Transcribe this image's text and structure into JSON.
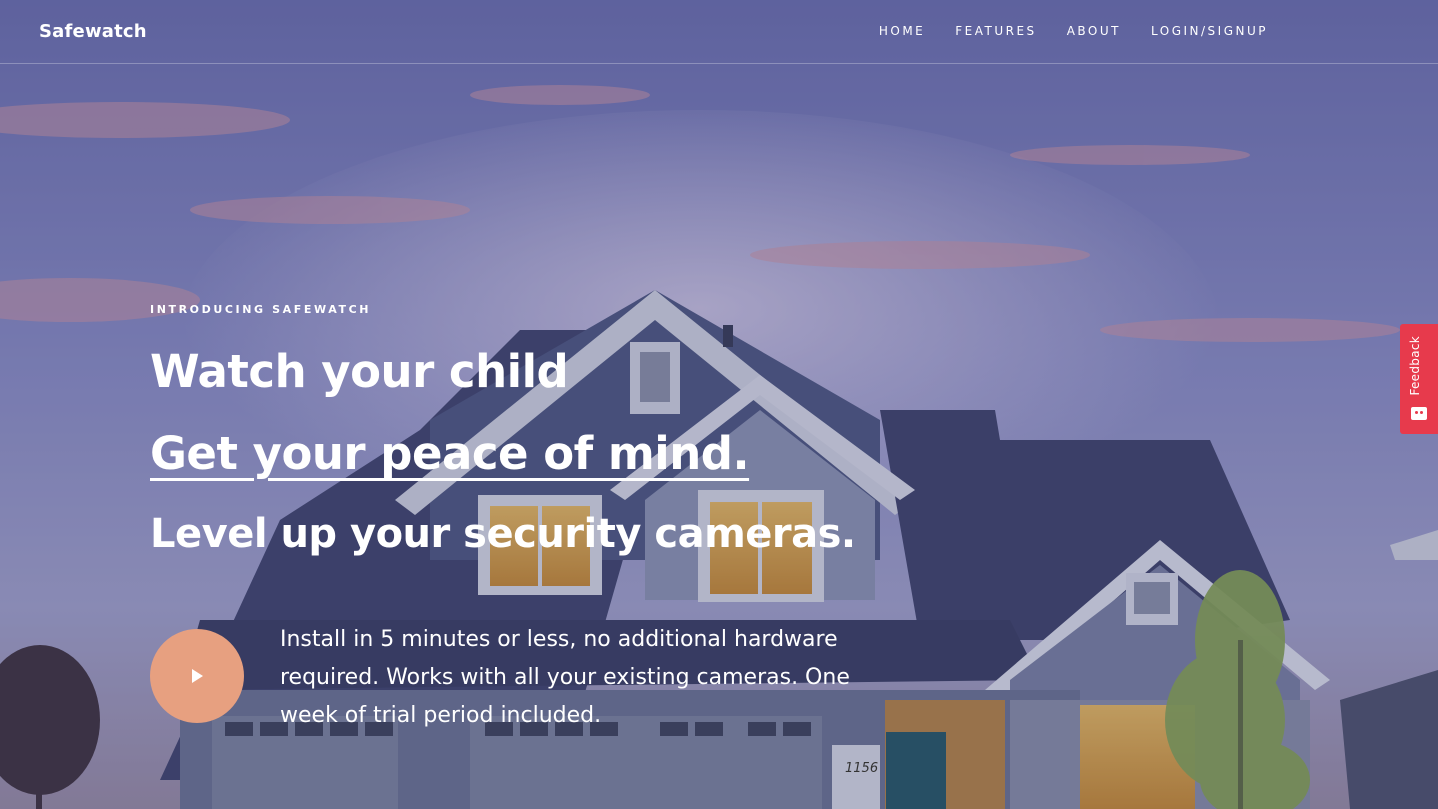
{
  "header": {
    "logo": "Safewatch",
    "nav": [
      "HOME",
      "FEATURES",
      "ABOUT",
      "LOGIN/SIGNUP"
    ]
  },
  "hero": {
    "eyebrow": "INTRODUCING SAFEWATCH",
    "line1": "Watch your child",
    "line2": "Get your peace of mind.",
    "line3": "Level up your security cameras.",
    "description": "Install in 5 minutes or less, no additional hardware required. Works with all your existing cameras. One week of trial period included.",
    "house_number": "1156"
  },
  "play_button": {
    "icon": "play-icon",
    "color": "#e7a080"
  },
  "feedback_tab": {
    "label": "Feedback",
    "icon": "smiley-icon",
    "color": "#e73a4c"
  }
}
